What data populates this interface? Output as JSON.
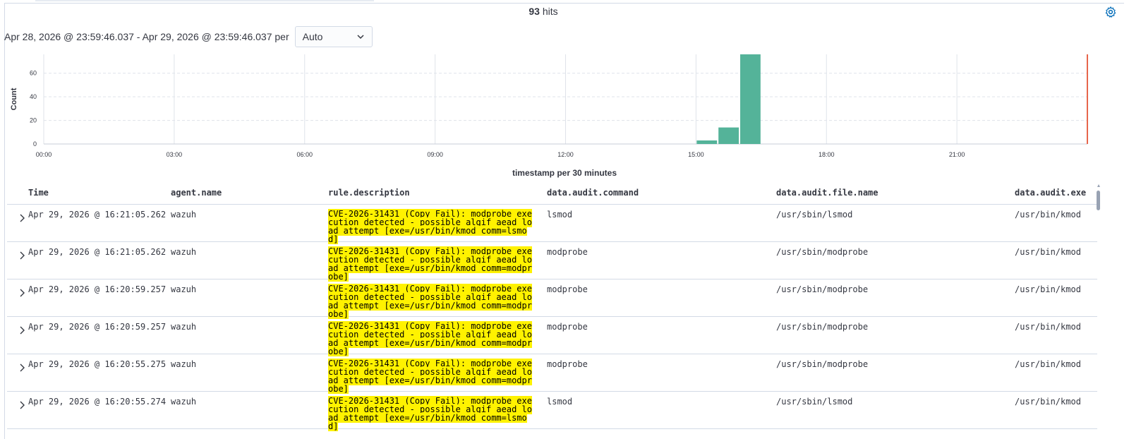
{
  "header": {
    "hits_count": "93",
    "hits_label": "hits",
    "time_range": "Apr 28, 2026 @ 23:59:46.037 - Apr 29, 2026 @ 23:59:46.037 per",
    "interval_value": "Auto"
  },
  "chart_data": {
    "type": "bar",
    "ylabel": "Count",
    "xlabel": "timestamp per 30 minutes",
    "x_ticks": [
      "00:00",
      "03:00",
      "06:00",
      "09:00",
      "12:00",
      "15:00",
      "18:00",
      "21:00"
    ],
    "y_ticks": [
      "0",
      "20",
      "40",
      "60"
    ],
    "ylim": [
      0,
      76
    ],
    "bars": [
      {
        "start": "15:00",
        "value": 3
      },
      {
        "start": "15:30",
        "value": 14
      },
      {
        "start": "16:00",
        "value": 76
      }
    ],
    "grid": true,
    "colors": {
      "bar": "#54b399",
      "now_marker": "#e7664c"
    }
  },
  "table": {
    "columns": [
      "Time",
      "agent.name",
      "rule.description",
      "data.audit.command",
      "data.audit.file.name",
      "data.audit.exe"
    ],
    "rows": [
      {
        "time": "Apr 29, 2026 @ 16:21:05.262",
        "agent": "wazuh",
        "desc": "CVE-2026-31431 (Copy Fail): modprobe execution detected - possible algif_aead load attempt [exe=/usr/bin/kmod comm=lsmod]",
        "command": "lsmod",
        "file": "/usr/sbin/lsmod",
        "exe": "/usr/bin/kmod"
      },
      {
        "time": "Apr 29, 2026 @ 16:21:05.262",
        "agent": "wazuh",
        "desc": "CVE-2026-31431 (Copy Fail): modprobe execution detected - possible algif_aead load attempt [exe=/usr/bin/kmod comm=modprobe]",
        "command": "modprobe",
        "file": "/usr/sbin/modprobe",
        "exe": "/usr/bin/kmod"
      },
      {
        "time": "Apr 29, 2026 @ 16:20:59.257",
        "agent": "wazuh",
        "desc": "CVE-2026-31431 (Copy Fail): modprobe execution detected - possible algif_aead load attempt [exe=/usr/bin/kmod comm=modprobe]",
        "command": "modprobe",
        "file": "/usr/sbin/modprobe",
        "exe": "/usr/bin/kmod"
      },
      {
        "time": "Apr 29, 2026 @ 16:20:59.257",
        "agent": "wazuh",
        "desc": "CVE-2026-31431 (Copy Fail): modprobe execution detected - possible algif_aead load attempt [exe=/usr/bin/kmod comm=modprobe]",
        "command": "modprobe",
        "file": "/usr/sbin/modprobe",
        "exe": "/usr/bin/kmod"
      },
      {
        "time": "Apr 29, 2026 @ 16:20:55.275",
        "agent": "wazuh",
        "desc": "CVE-2026-31431 (Copy Fail): modprobe execution detected - possible algif_aead load attempt [exe=/usr/bin/kmod comm=modprobe]",
        "command": "modprobe",
        "file": "/usr/sbin/modprobe",
        "exe": "/usr/bin/kmod"
      },
      {
        "time": "Apr 29, 2026 @ 16:20:55.274",
        "agent": "wazuh",
        "desc": "CVE-2026-31431 (Copy Fail): modprobe execution detected - possible algif_aead load attempt [exe=/usr/bin/kmod comm=lsmod]",
        "command": "lsmod",
        "file": "/usr/sbin/lsmod",
        "exe": "/usr/bin/kmod"
      }
    ]
  }
}
